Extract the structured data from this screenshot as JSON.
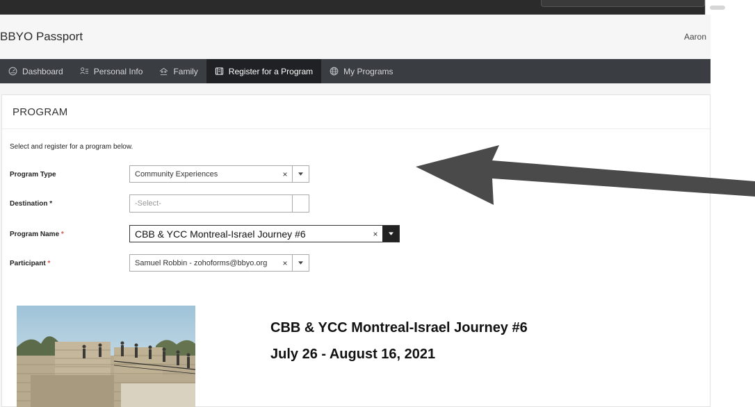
{
  "header": {
    "brand": "BBYO Passport",
    "user_name": "Aaron"
  },
  "nav": {
    "items": [
      {
        "label": "Dashboard",
        "icon": "dashboard-icon",
        "active": false
      },
      {
        "label": "Personal Info",
        "icon": "person-info-icon",
        "active": false
      },
      {
        "label": "Family",
        "icon": "family-icon",
        "active": false
      },
      {
        "label": "Register for a Program",
        "icon": "register-icon",
        "active": true
      },
      {
        "label": "My Programs",
        "icon": "globe-icon",
        "active": false
      }
    ]
  },
  "card": {
    "title": "PROGRAM",
    "intro": "Select and register for a program below."
  },
  "form": {
    "program_type": {
      "label": "Program Type",
      "value": "Community Experiences",
      "clear": "×"
    },
    "destination": {
      "label": "Destination",
      "required": "*",
      "placeholder": "-Select-"
    },
    "program_name": {
      "label": "Program Name",
      "required": "*",
      "value": "CBB & YCC Montreal-Israel Journey #6",
      "clear": "×"
    },
    "participant": {
      "label": "Participant",
      "required": "*",
      "value": "Samuel Robbin - zohoforms@bbyo.org",
      "clear": "×"
    }
  },
  "program": {
    "title": "CBB & YCC Montreal-Israel Journey #6",
    "dates": "July 26 - August 16, 2021",
    "image": "program-photo-stone-ruins"
  },
  "colors": {
    "navbar_bg": "#3a3d42",
    "navbar_active_bg": "#1f2124",
    "required": "#d9534f",
    "annotation_arrow": "#4a4a4a"
  }
}
